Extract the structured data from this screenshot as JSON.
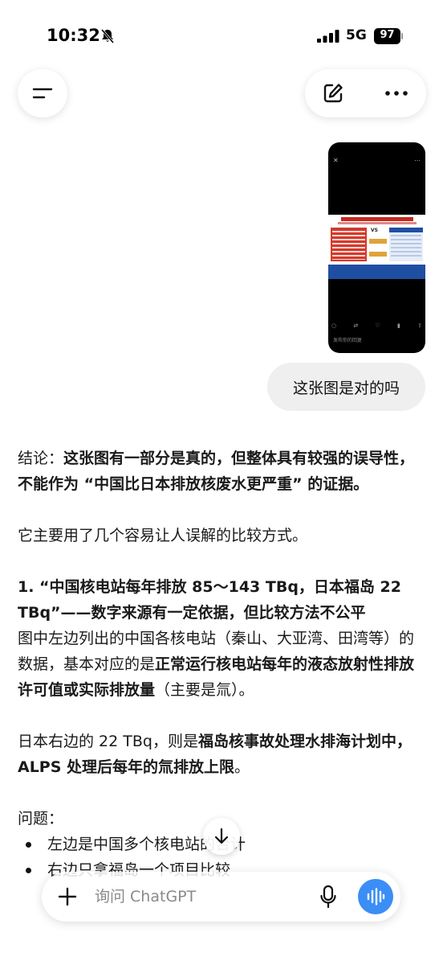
{
  "status_bar": {
    "time": "10:32",
    "network": "5G",
    "battery": "97"
  },
  "header": {
    "menu_icon": "menu-icon",
    "edit_icon": "compose-icon",
    "more_icon": "more-icon"
  },
  "attached_image": {
    "caption": "发布你的回复"
  },
  "user_message": "这张图是对的吗",
  "assistant": {
    "conclusion_label": "结论：",
    "conclusion_text": "这张图有一部分是真的，但整体具有较强的误导性，不能作为 “中国比日本排放核废水更严重” 的证据。",
    "intro": "它主要用了几个容易让人误解的比较方式。",
    "point1_heading": "1. “中国核电站每年排放 85～143 TBq，日本福岛 22 TBq”——数字来源有一定依据，但比较方法不公平",
    "p2_part1": "图中左边列出的中国各核电站（秦山、大亚湾、田湾等）的数据，基本对应的是",
    "p2_bold": "正常运行核电站每年的液态放射性排放许可值或实际排放量",
    "p2_part2": "（主要是氚）。",
    "p3_part1": "日本右边的 22 TBq，则是",
    "p3_bold": "福岛核事故处理水排海计划中，ALPS 处理后每年的氚排放上限",
    "p3_part2": "。",
    "problem_label": "问题：",
    "bullets": [
      "左边是中国多个核电站的合计",
      "右边只拿福岛一个项目比较"
    ]
  },
  "composer": {
    "placeholder": "询问 ChatGPT"
  },
  "colors": {
    "accent": "#3a8ef6",
    "bubble": "#efefef"
  }
}
